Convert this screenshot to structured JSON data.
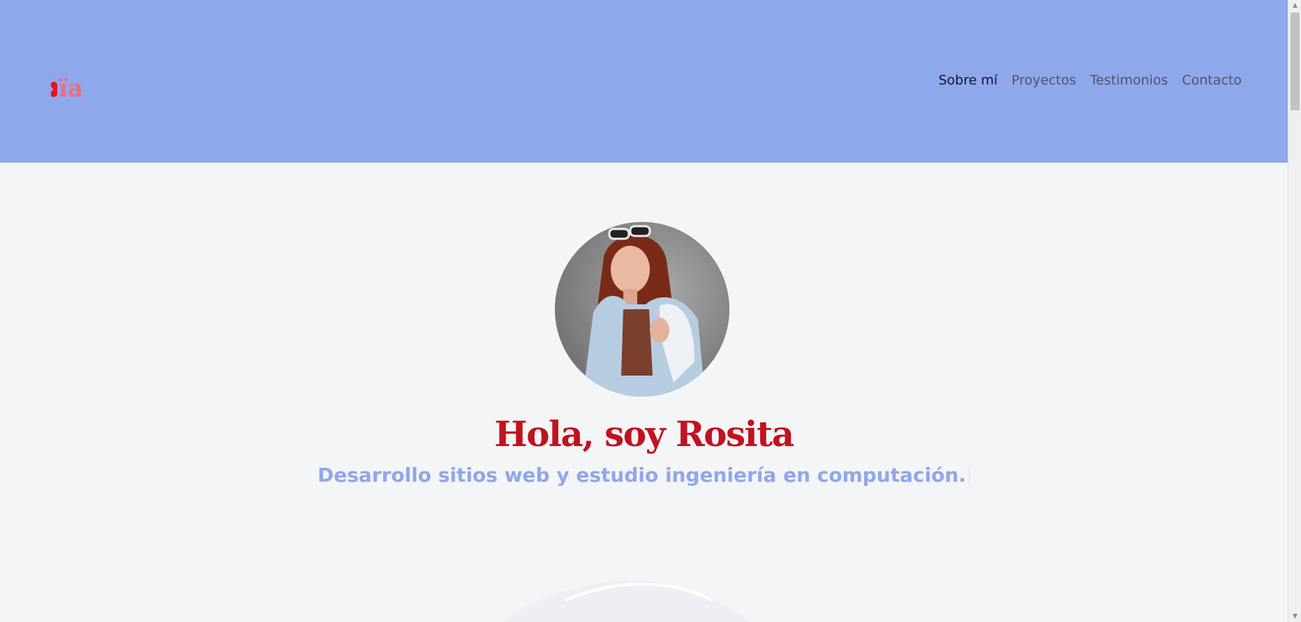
{
  "brand": {
    "logo_text": "ïa"
  },
  "nav": {
    "items": [
      {
        "label": "Sobre mí",
        "active": true
      },
      {
        "label": "Proyectos",
        "active": false
      },
      {
        "label": "Testimonios",
        "active": false
      },
      {
        "label": "Contacto",
        "active": false
      }
    ]
  },
  "hero": {
    "title": "Hola, soy Rosita",
    "subtitle": "Desarrollo sitios web y estudio ingeniería en computación."
  },
  "colors": {
    "header_bg": "#8fa7eb",
    "accent_red": "#c1121f",
    "subtitle_blue": "#8fa7eb",
    "page_bg": "#f4f5f7"
  }
}
